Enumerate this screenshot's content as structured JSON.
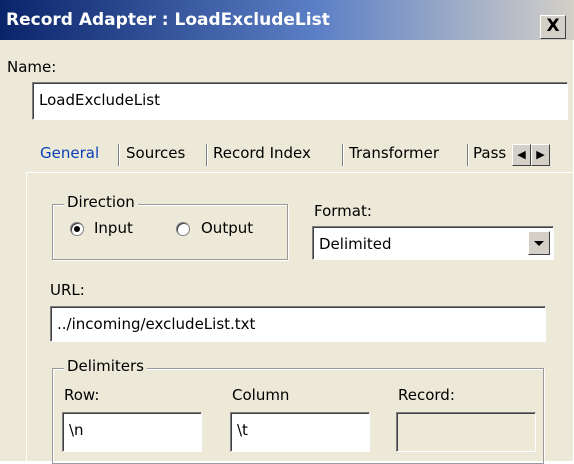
{
  "window": {
    "title": "Record Adapter : LoadExcludeList",
    "close_label": "X"
  },
  "name": {
    "label": "Name:",
    "value": "LoadExcludeList"
  },
  "tabs": [
    {
      "label": "General",
      "active": true
    },
    {
      "label": "Sources",
      "active": false
    },
    {
      "label": "Record Index",
      "active": false
    },
    {
      "label": "Transformer",
      "active": false
    },
    {
      "label": "Pass",
      "active": false
    }
  ],
  "tab_scroll": {
    "left": "◀",
    "right": "▶"
  },
  "general": {
    "direction": {
      "title": "Direction",
      "options": [
        {
          "label": "Input",
          "selected": true
        },
        {
          "label": "Output",
          "selected": false
        }
      ]
    },
    "format": {
      "label": "Format:",
      "value": "Delimited"
    },
    "url": {
      "label": "URL:",
      "value": "../incoming/excludeList.txt"
    },
    "delimiters": {
      "title": "Delimiters",
      "row": {
        "label": "Row:",
        "value": "\\n"
      },
      "column": {
        "label": "Column",
        "value": "\\t"
      },
      "record": {
        "label": "Record:",
        "value": ""
      }
    }
  },
  "colors": {
    "title_start": "#0a246a",
    "title_end": "#d4d0c8",
    "face": "#ece9d8",
    "active_tab": "#0a3fb6"
  }
}
